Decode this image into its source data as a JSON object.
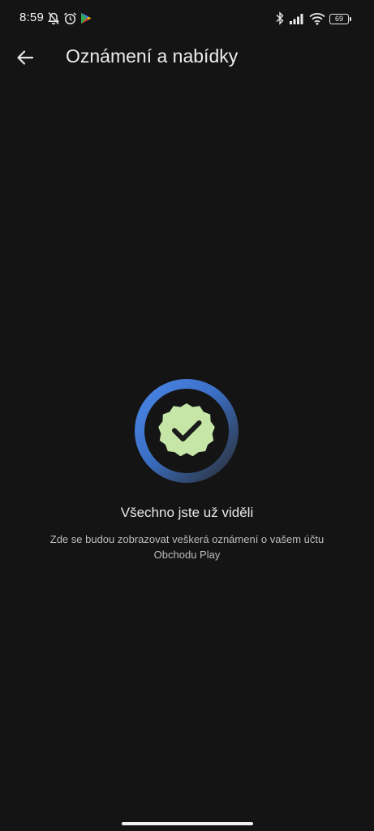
{
  "status_bar": {
    "time": "8:59",
    "battery": "69",
    "left_icons": [
      "bell-off-icon",
      "alarm-icon",
      "play-store-icon"
    ],
    "right_icons": [
      "bluetooth-icon",
      "signal-icon",
      "wifi-icon",
      "battery-icon"
    ]
  },
  "app_bar": {
    "title": "Oznámení a nabídky",
    "back_icon": "arrow-back-icon"
  },
  "empty_state": {
    "title": "Všechno jste už viděli",
    "description": "Zde se budou zobrazovat veškerá oznámení o vašem účtu Obchodu Play",
    "icon": "verified-check-badge-icon"
  },
  "colors": {
    "background": "#141414",
    "ring_start": "#4a86e8",
    "ring_end": "#2b2f36",
    "badge": "#c5e6a6",
    "check": "#1a1a1a"
  }
}
